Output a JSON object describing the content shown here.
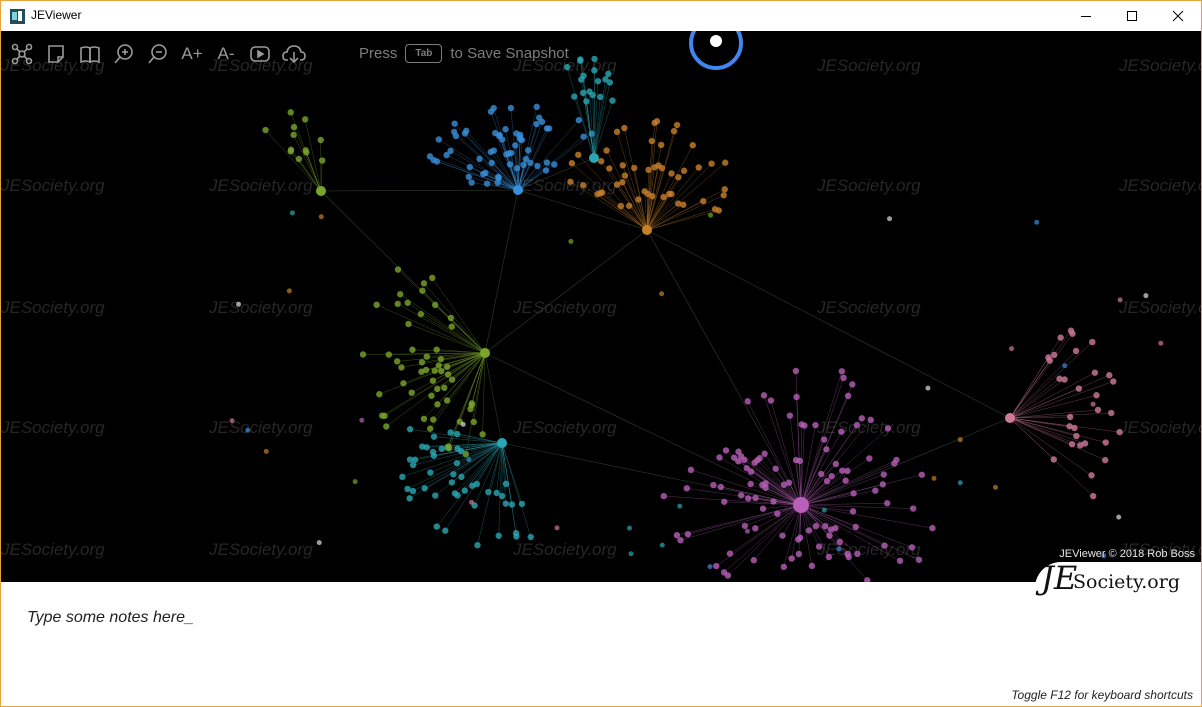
{
  "window": {
    "title": "JEViewer",
    "accent_border": "#e8a33d",
    "controls": [
      "minimize",
      "maximize",
      "close"
    ]
  },
  "toolbar": {
    "icons": [
      "network-graph-icon",
      "sticky-note-icon",
      "book-icon",
      "zoom-in-icon",
      "zoom-out-icon",
      "font-increase-icon",
      "font-decrease-icon",
      "play-video-icon",
      "cloud-download-icon"
    ],
    "font_increase_label": "A+",
    "font_decrease_label": "A-"
  },
  "snapshot": {
    "press": "Press",
    "key": "Tab",
    "action": "to Save  Snapshot"
  },
  "graph": {
    "background": "#000000",
    "watermark": "JESociety.org",
    "cluster_colors": [
      "#3a8fd9",
      "#c87f2a",
      "#7aa52b",
      "#b85fb8",
      "#2aa7b3",
      "#d07a9a",
      "#e0e0e0"
    ]
  },
  "copyright": "JEViewer © 2018 Rob Boss",
  "logo": {
    "mark": "JE",
    "text": "Society.org"
  },
  "notes": {
    "placeholder": "Type some notes here_"
  },
  "hint": "Toggle F12 for keyboard shortcuts"
}
